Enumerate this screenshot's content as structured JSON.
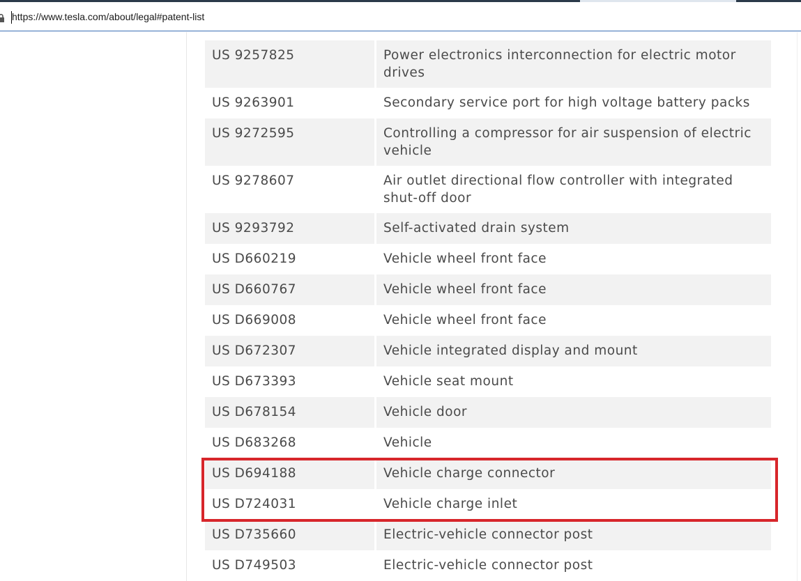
{
  "browser": {
    "url": "https://www.tesla.com/about/legal#patent-list"
  },
  "patents": [
    {
      "number": "US 9257825",
      "title": "Power electronics interconnection for electric motor drives"
    },
    {
      "number": "US 9263901",
      "title": "Secondary service port for high voltage battery packs"
    },
    {
      "number": "US 9272595",
      "title": "Controlling a compressor for air suspension of electric vehicle"
    },
    {
      "number": "US 9278607",
      "title": "Air outlet directional flow controller with integrated shut-off door"
    },
    {
      "number": "US 9293792",
      "title": "Self-activated drain system"
    },
    {
      "number": "US D660219",
      "title": "Vehicle wheel front face"
    },
    {
      "number": "US D660767",
      "title": "Vehicle wheel front face"
    },
    {
      "number": "US D669008",
      "title": "Vehicle wheel front face"
    },
    {
      "number": "US D672307",
      "title": "Vehicle integrated display and mount"
    },
    {
      "number": "US D673393",
      "title": "Vehicle seat mount"
    },
    {
      "number": "US D678154",
      "title": "Vehicle door"
    },
    {
      "number": "US D683268",
      "title": "Vehicle"
    },
    {
      "number": "US D694188",
      "title": "Vehicle charge connector"
    },
    {
      "number": "US D724031",
      "title": "Vehicle charge inlet"
    },
    {
      "number": "US D735660",
      "title": "Electric-vehicle connector post"
    },
    {
      "number": "US D749503",
      "title": "Electric-vehicle connector post"
    }
  ],
  "highlight": {
    "color": "#d7262b",
    "rows": [
      "US D694188",
      "US D724031"
    ]
  },
  "icons": {
    "address_bar": "lock-icon"
  }
}
